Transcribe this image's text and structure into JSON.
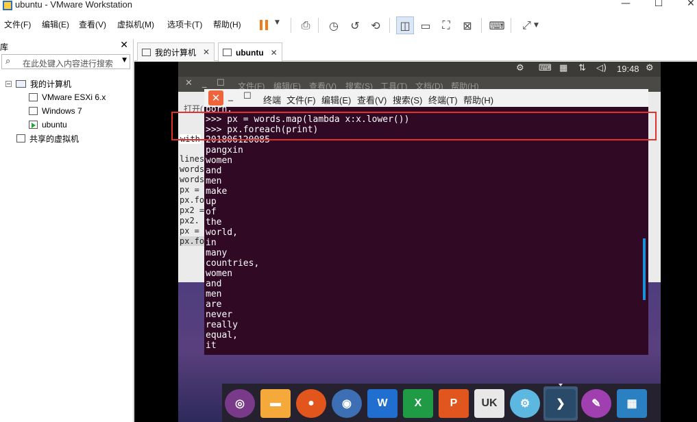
{
  "window": {
    "title": "ubuntu - VMware Workstation",
    "minimize": "—",
    "maximize": "☐",
    "close": "✕"
  },
  "menu": [
    "文件(F)",
    "编辑(E)",
    "查看(V)",
    "虚拟机(M)",
    "选项卡(T)",
    "帮助(H)"
  ],
  "library": {
    "title": "库",
    "close": "✕",
    "search_placeholder": "在此处键入内容进行搜索",
    "tree": {
      "root": "我的计算机",
      "items": [
        "VMware ESXi 6.x",
        "Windows 7",
        "ubuntu"
      ],
      "shared": "共享的虚拟机"
    }
  },
  "tabs": [
    {
      "label": "我的计算机",
      "close": "✕"
    },
    {
      "label": "ubuntu",
      "close": "✕"
    }
  ],
  "ubuntu_topbar": {
    "time": "19:48"
  },
  "bg_terminal": {
    "menu": [
      "文件(F)",
      "编辑(E)",
      "查看(V)",
      "搜索(S)",
      "工具(T)",
      "文档(D)",
      "帮助(H)"
    ],
    "open_label": "打开(",
    "lines": [
      "with",
      "lines",
      "words",
      "words",
      "px =",
      "px.fo",
      "px2 =",
      "px2.",
      "px =",
      "px.fo"
    ]
  },
  "terminal": {
    "menu": [
      "终端",
      "文件(F)",
      "编辑(E)",
      "查看(V)",
      "搜索(S)",
      "终端(T)",
      "帮助(H)"
    ],
    "lines": [
      "born.",
      ">>> px = words.map(lambda x:x.lower())",
      ">>> px.foreach(print)",
      "201806120085",
      "pangxin",
      "women",
      "and",
      "men",
      "make",
      "up",
      "of",
      "the",
      "world,",
      "in",
      "many",
      "countries,",
      "women",
      "and",
      "men",
      "are",
      "never",
      "really",
      "equal,",
      "it"
    ]
  },
  "dock": {
    "items": [
      "ubuntu-logo",
      "files",
      "firefox",
      "chromium",
      "writer",
      "calc",
      "impress",
      "software-center",
      "system-settings",
      "terminal",
      "text-editor",
      "workspaces",
      "trash"
    ],
    "labels": {
      "writer": "W",
      "calc": "X",
      "impress": "P",
      "software": "UK"
    }
  }
}
